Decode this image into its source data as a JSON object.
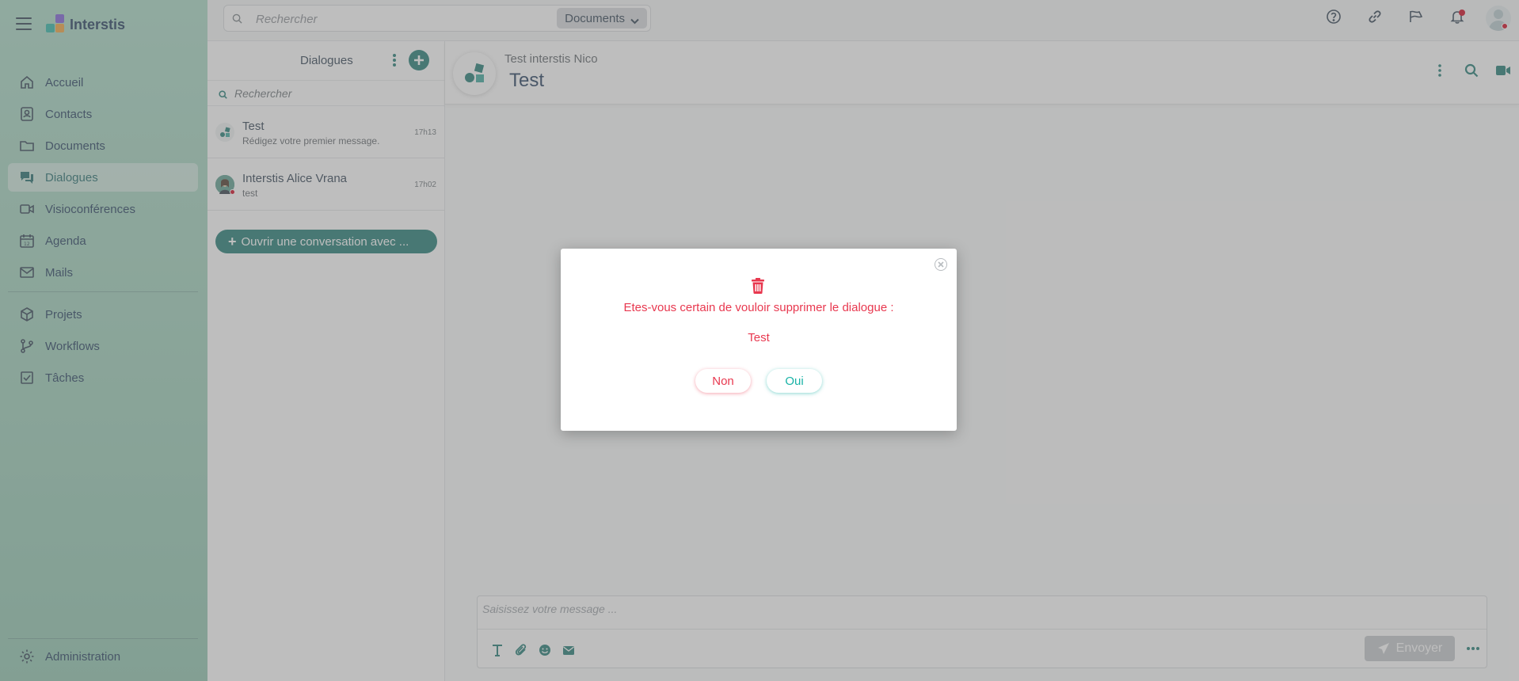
{
  "app": {
    "brand": "Interstis"
  },
  "colors": {
    "accent": "#1d7a72",
    "danger": "#e8384f",
    "teal": "#18b2a6"
  },
  "sidebar": {
    "items": [
      {
        "label": "Accueil",
        "icon": "home-icon"
      },
      {
        "label": "Contacts",
        "icon": "contacts-icon"
      },
      {
        "label": "Documents",
        "icon": "folder-icon"
      },
      {
        "label": "Dialogues",
        "icon": "chat-icon"
      },
      {
        "label": "Visioconférences",
        "icon": "video-icon"
      },
      {
        "label": "Agenda",
        "icon": "calendar-icon"
      },
      {
        "label": "Mails",
        "icon": "mail-icon"
      },
      {
        "label": "Projets",
        "icon": "cube-icon"
      },
      {
        "label": "Workflows",
        "icon": "workflow-icon"
      },
      {
        "label": "Tâches",
        "icon": "checkbox-icon"
      }
    ],
    "admin_label": "Administration"
  },
  "topbar": {
    "search_placeholder": "Rechercher",
    "scope": "Documents"
  },
  "dialogs": {
    "title": "Dialogues",
    "search_placeholder": "Rechercher",
    "items": [
      {
        "name": "Test",
        "message": "Rédigez votre premier message.",
        "time": "17h13"
      },
      {
        "name": "Interstis Alice Vrana",
        "message": "test",
        "time": "17h02"
      }
    ],
    "open_button": "Ouvrir une conversation avec ..."
  },
  "chat": {
    "subtitle": "Test interstis Nico",
    "title": "Test",
    "composer_placeholder": "Saisissez votre message ...",
    "send_label": "Envoyer"
  },
  "modal": {
    "question": "Etes-vous certain de vouloir supprimer le dialogue :",
    "target": "Test",
    "no_label": "Non",
    "yes_label": "Oui"
  }
}
